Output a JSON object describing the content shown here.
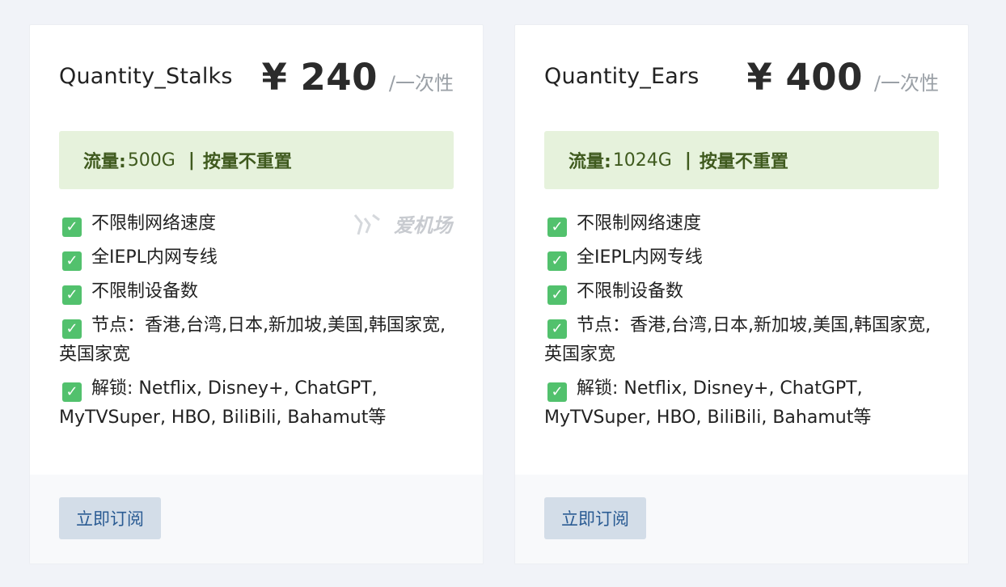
{
  "plans": [
    {
      "name": "Quantity_Stalks",
      "price": "¥ 240",
      "period": "/一次性",
      "traffic_label": "流量:",
      "traffic_amount": "500G",
      "traffic_sep": "|",
      "traffic_note": "按量不重置",
      "features": [
        "不限制网络速度",
        "全IEPL内网专线",
        "不限制设备数",
        "节点：香港,台湾,日本,新加坡,美国,韩国家宽,英国家宽",
        "解锁: Netflix, Disney+, ChatGPT, MyTVSuper, HBO, BiliBili, Bahamut等"
      ],
      "button": "立即订阅"
    },
    {
      "name": "Quantity_Ears",
      "price": "¥ 400",
      "period": "/一次性",
      "traffic_label": "流量:",
      "traffic_amount": "1024G",
      "traffic_sep": "|",
      "traffic_note": "按量不重置",
      "features": [
        "不限制网络速度",
        "全IEPL内网专线",
        "不限制设备数",
        "节点：香港,台湾,日本,新加坡,美国,韩国家宽,英国家宽",
        "解锁: Netflix, Disney+, ChatGPT, MyTVSuper, HBO, BiliBili, Bahamut等"
      ],
      "button": "立即订阅"
    }
  ],
  "watermark": "爱机场",
  "icons": {
    "feature": "check-mark-icon",
    "watermark": "watermark-logo-icon"
  },
  "colors": {
    "traffic_bg": "#e6f2dc",
    "traffic_text": "#3f5a1e",
    "check": "#52c16d",
    "button_bg": "#d3dde8",
    "button_text": "#2a5b93"
  }
}
